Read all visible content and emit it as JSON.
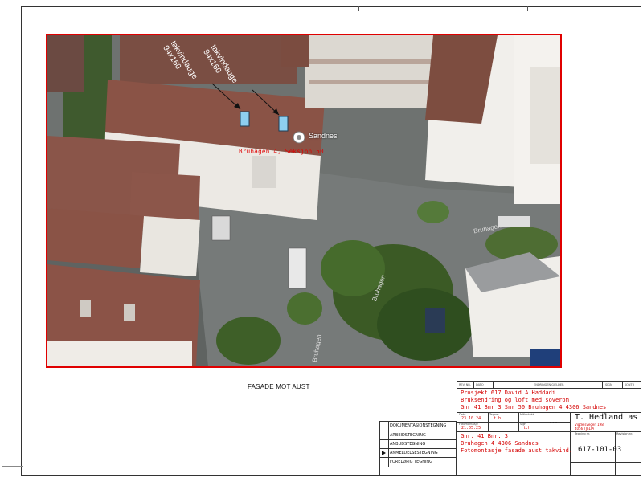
{
  "photo": {
    "label_left_1": "takvindauge",
    "label_left_2": "94x160",
    "label_right_1": "takvindauge",
    "label_right_2": "94x160",
    "map_pin_label": "Sandnes",
    "property_label": "Bruhagen 4, Seksjon 50",
    "street_label_1": "Bruhagen",
    "street_label_2": "Bruhagen",
    "street_label_3": "Bruhagen"
  },
  "caption": "FASADE MOT AUST",
  "title_block": {
    "header_fields": [
      "REV. NR.",
      "DATO",
      "ENDRINGEN GJELDER",
      "SIGN",
      "KONTR"
    ],
    "project_line_1": "Prosjekt 617 David A Haddadi",
    "project_line_2": "Bruksendring og loft med soverom",
    "project_line_3": "Gnr 41 Bnr 3 Snr 50 Bruhagen 4   4306 Sandnes",
    "drawn_date_label": "Dato",
    "drawn_date": "23.10.24",
    "drawn_by_label": "Tegnet",
    "drawn_by": "t.h",
    "scale_label": "Målestokk",
    "scale_value": "---",
    "photo_date_label": "Fotomontasje",
    "photo_date": "21.05.25",
    "photo_sign_label": "Sign",
    "photo_sign": "t.h",
    "location_line_1": "Gnr. 41 Bnr. 3",
    "location_line_2": "Bruhagen 4   4306 Sandnes",
    "location_line_3": "Fotomontasje fasade aust takvind.",
    "company_name": "T. Hedland as",
    "company_addr_1": "Vigdelsvegen 198",
    "company_addr_2": "4056   TJELTA",
    "tegning_nr_label": "Tegning nr.",
    "revisjon_label": "Revisjon nr.",
    "drawing_number": "617-101-03"
  },
  "categories": [
    {
      "label": "DOKUMENTASJONSTEGNING",
      "selected": false
    },
    {
      "label": "ARBEIDSTEGNING",
      "selected": false
    },
    {
      "label": "ANBUDSTEGNING",
      "selected": false
    },
    {
      "label": "ANMELDELSESTEGNING",
      "selected": true
    },
    {
      "label": "FORELØPIG TEGNING",
      "selected": false
    }
  ],
  "colors": {
    "frame_red": "#e00000",
    "text_red": "#d40000",
    "window_blue": "#8ecff0"
  }
}
